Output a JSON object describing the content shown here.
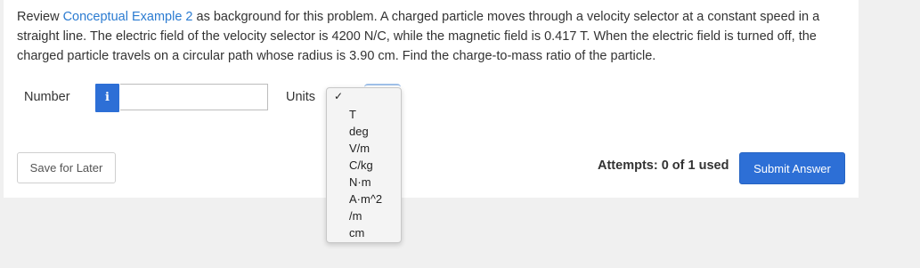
{
  "question": {
    "text_before_link": "Review ",
    "link_text": "Conceptual Example 2",
    "text_after_link": " as background for this problem. A charged particle moves through a velocity selector at a constant speed in a straight line. The electric field of the velocity selector is 4200 N/C, while the magnetic field is 0.417 T. When the electric field is turned off, the charged particle travels on a circular path whose radius is 3.90 cm. Find the charge-to-mass ratio of the particle.",
    "link_color": "#2b7bd1"
  },
  "answer": {
    "number_label": "Number",
    "info_icon": "i",
    "number_value": "",
    "units_label": "Units"
  },
  "units_dropdown": {
    "selected_check": "✓",
    "options": [
      "T",
      "deg",
      "V/m",
      "C/kg",
      "N·m",
      "A·m^2",
      "/m",
      "cm"
    ]
  },
  "footer": {
    "save_label": "Save for Later",
    "attempts_text": "Attempts: 0 of 1 used",
    "submit_label": "Submit Answer",
    "accent_color": "#2d6fd6"
  }
}
